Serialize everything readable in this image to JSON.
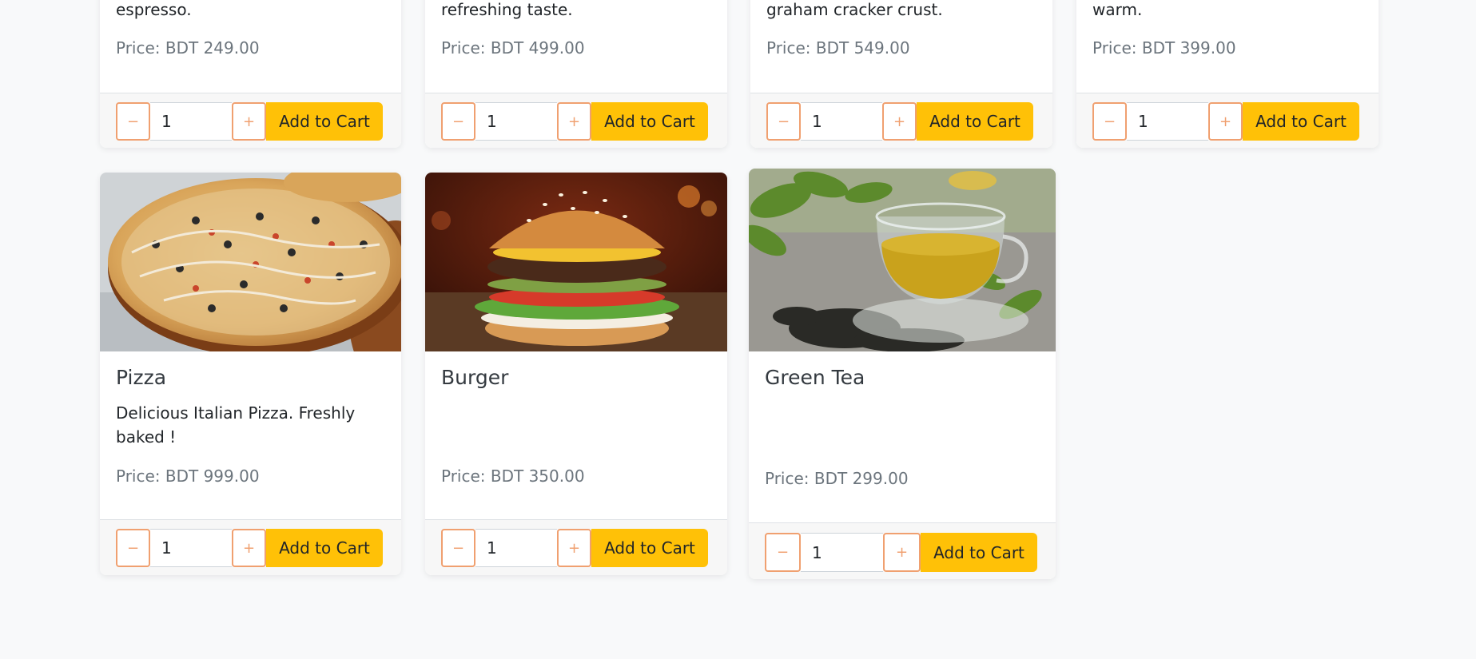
{
  "cart": {
    "minus_label": "−",
    "plus_label": "+",
    "qty_value": "1",
    "add_label": "Add to Cart"
  },
  "top_row": [
    {
      "desc_tail": "espresso.",
      "price": "Price: BDT 249.00"
    },
    {
      "desc_tail": "refreshing taste.",
      "price": "Price: BDT 499.00"
    },
    {
      "desc_tail": "graham cracker crust.",
      "price": "Price: BDT 549.00"
    },
    {
      "desc_tail": "warm.",
      "price": "Price: BDT 399.00"
    }
  ],
  "bottom_row": [
    {
      "title": "Pizza",
      "desc": "Delicious Italian Pizza. Freshly baked !",
      "price": "Price: BDT 999.00"
    },
    {
      "title": "Burger",
      "desc": "",
      "price": "Price: BDT 350.00"
    },
    {
      "title": "Green Tea",
      "desc": "",
      "price": "Price: BDT 299.00"
    }
  ],
  "colors": {
    "page_bg": "#f8f9fa",
    "accent_button": "#ffc107",
    "qty_border": "#f0a070"
  }
}
